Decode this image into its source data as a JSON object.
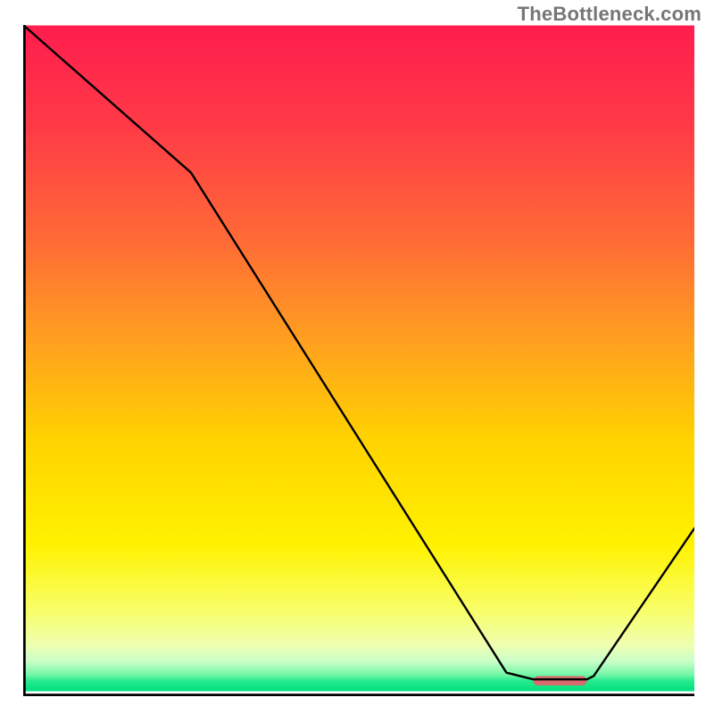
{
  "watermark": "TheBottleneck.com",
  "chart_data": {
    "type": "line",
    "title": "",
    "xlabel": "",
    "ylabel": "",
    "xlim": [
      0,
      100
    ],
    "ylim": [
      0,
      100
    ],
    "grid": false,
    "x": [
      0,
      25,
      72,
      76,
      84,
      85,
      100
    ],
    "values": [
      100,
      78,
      3.5,
      2.5,
      2.5,
      3.0,
      25
    ],
    "marker": {
      "x_range": [
        76,
        84
      ],
      "y": 2.3,
      "color": "#d66b6e",
      "height_pct": 1.4
    },
    "gradient_stops": [
      {
        "t": 0.0,
        "c": "#ff1d4e"
      },
      {
        "t": 0.15,
        "c": "#ff3a47"
      },
      {
        "t": 0.32,
        "c": "#ff6a36"
      },
      {
        "t": 0.48,
        "c": "#ffa21e"
      },
      {
        "t": 0.62,
        "c": "#ffd200"
      },
      {
        "t": 0.78,
        "c": "#fff200"
      },
      {
        "t": 0.88,
        "c": "#f8ff6a"
      },
      {
        "t": 0.93,
        "c": "#efffb0"
      },
      {
        "t": 0.955,
        "c": "#caffc8"
      },
      {
        "t": 0.975,
        "c": "#74f7a8"
      },
      {
        "t": 0.985,
        "c": "#24ea8e"
      },
      {
        "t": 1.0,
        "c": "#00e07b"
      }
    ],
    "axes_color": "#000000",
    "line_color": "#000000",
    "line_width": 2.4
  }
}
